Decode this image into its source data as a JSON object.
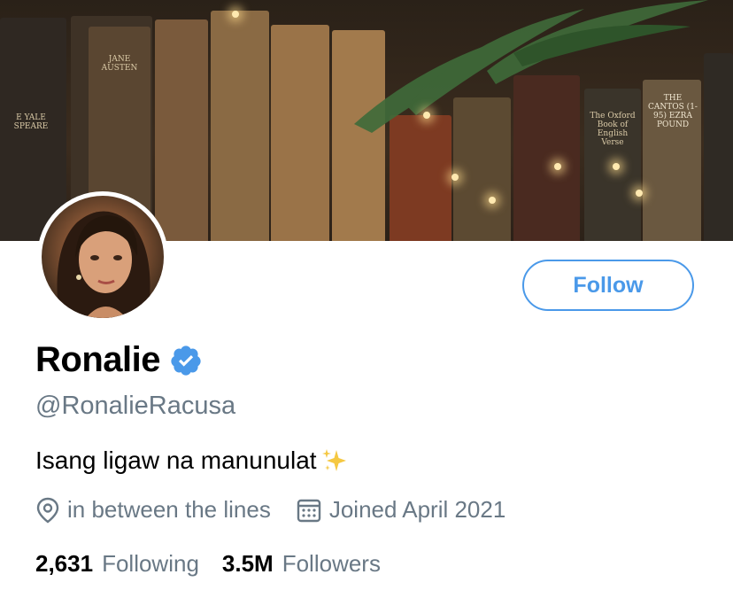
{
  "profile": {
    "display_name": "Ronalie",
    "handle": "@RonalieRacusa",
    "bio": "Isang ligaw na manunulat",
    "bio_emoji": "sparkles-icon",
    "location": "in between the lines",
    "joined": "Joined April 2021",
    "verified": true
  },
  "actions": {
    "follow_label": "Follow"
  },
  "stats": {
    "following_count": "2,631",
    "following_label": "Following",
    "followers_count": "3.5M",
    "followers_label": "Followers"
  },
  "banner": {
    "book_titles": [
      "JANE AUSTEN",
      "THE CANTOS (1-95) EZRA POUND",
      "The Oxford Book of English Verse",
      "E YALE SPEARE"
    ]
  },
  "colors": {
    "accent": "#4a99e9",
    "secondary_text": "#697885",
    "primary_text": "#000000"
  }
}
